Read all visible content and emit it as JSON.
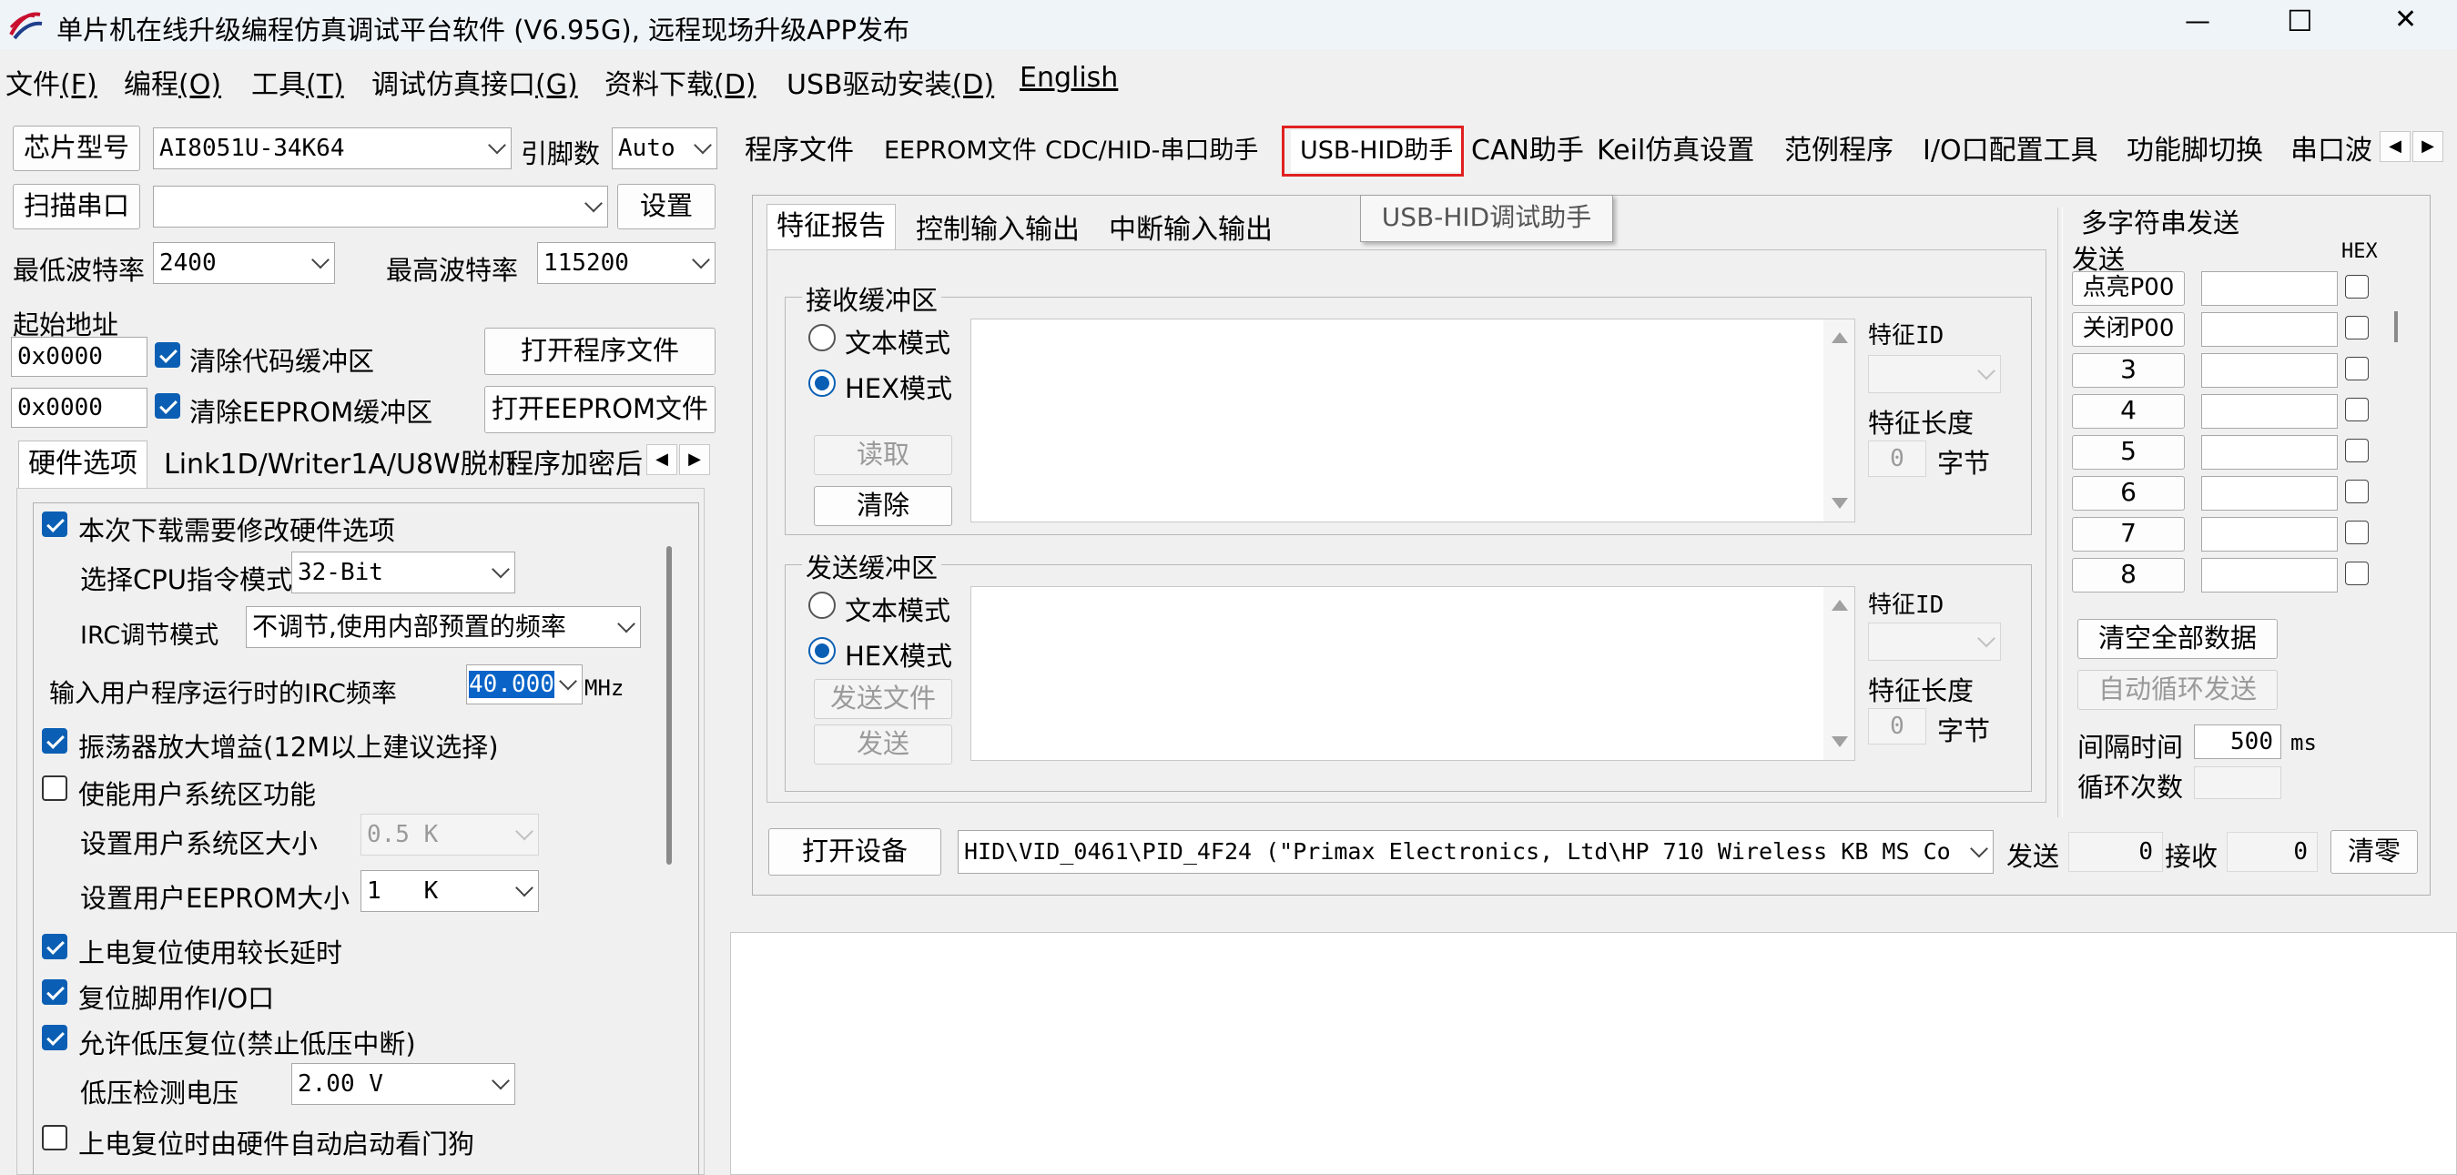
{
  "window": {
    "title": "单片机在线升级编程仿真调试平台软件 (V6.95G), 远程现场升级APP发布",
    "minimize": "—",
    "maximize": "☐",
    "close": "✕"
  },
  "menu": [
    {
      "label": "文件",
      "key": "(F)"
    },
    {
      "label": "编程",
      "key": "(O)"
    },
    {
      "label": "工具",
      "key": "(T)"
    },
    {
      "label": "调试仿真接口",
      "key": "(G)"
    },
    {
      "label": "资料下载",
      "key": "(D)"
    },
    {
      "label": "USB驱动安装",
      "key": "(D)"
    },
    {
      "label": "English",
      "key": ""
    }
  ],
  "left": {
    "chip_btn": "芯片型号",
    "chip_value": "AI8051U-34K64",
    "pins_label": "引脚数",
    "pins_value": "Auto",
    "scan_btn": "扫描串口",
    "port_value": "",
    "settings_btn": "设置",
    "min_baud_label": "最低波特率",
    "min_baud_value": "2400",
    "max_baud_label": "最高波特率",
    "max_baud_value": "115200",
    "start_addr_label": "起始地址",
    "addr1": "0x0000",
    "clear_code_label": "清除代码缓冲区",
    "open_prog_btn": "打开程序文件",
    "addr2": "0x0000",
    "clear_eeprom_label": "清除EEPROM缓冲区",
    "open_eeprom_btn": "打开EEPROM文件",
    "tabs": [
      "硬件选项",
      "Link1D/Writer1A/U8W脱机",
      "程序加密后"
    ],
    "hw": {
      "modify_label": "本次下载需要修改硬件选项",
      "cpu_mode_label": "选择CPU指令模式",
      "cpu_mode_value": "32-Bit",
      "irc_mode_label": "IRC调节模式",
      "irc_mode_value": "不调节,使用内部预置的频率",
      "irc_freq_label": "输入用户程序运行时的IRC频率",
      "irc_freq_value": "40.000",
      "irc_freq_unit": "MHz",
      "osc_gain_label": "振荡器放大增益(12M以上建议选择)",
      "sysarea_label": "使能用户系统区功能",
      "sysarea_size_label": "设置用户系统区大小",
      "sysarea_size_value": "0.5 K",
      "eeprom_size_label": "设置用户EEPROM大小",
      "eeprom_size_value": "1   K",
      "long_delay_label": "上电复位使用较长延时",
      "reset_io_label": "复位脚用作I/O口",
      "lvr_label": "允许低压复位(禁止低压中断)",
      "lvd_label": "低压检测电压",
      "lvd_value": "2.00 V",
      "watchdog_label": "上电复位时由硬件自动启动看门狗"
    }
  },
  "main_tabs": [
    "程序文件",
    "EEPROM文件",
    "CDC/HID-串口助手",
    "USB-HID助手",
    "CAN助手",
    "Keil仿真设置",
    "范例程序",
    "I/O口配置工具",
    "功能脚切换",
    "串口波"
  ],
  "tooltip": "USB-HID调试助手",
  "hid": {
    "subtabs": [
      "特征报告",
      "控制输入输出",
      "中断输入输出"
    ],
    "recv_group": "接收缓冲区",
    "text_mode": "文本模式",
    "hex_mode": "HEX模式",
    "read_btn": "读取",
    "clear_btn": "清除",
    "feature_id_label": "特征ID",
    "feature_len_label": "特征长度",
    "len_value": "0",
    "bytes_unit": "字节",
    "send_group": "发送缓冲区",
    "send_file_btn": "发送文件",
    "send_btn": "发送",
    "open_device_btn": "打开设备",
    "device_value": "HID\\VID_0461\\PID_4F24 (\"Primax Electronics, Ltd\\HP 710 Wireless KB MS Co",
    "send_count_label": "发送",
    "send_count": "0",
    "recv_count_label": "接收",
    "recv_count": "0",
    "reset_btn": "清零"
  },
  "multi": {
    "title": "多字符串发送",
    "send_col": "发送",
    "hex_col": "HEX",
    "rows": [
      "点亮P00",
      "关闭P00",
      "3",
      "4",
      "5",
      "6",
      "7",
      "8"
    ],
    "clear_all_btn": "清空全部数据",
    "auto_loop_btn": "自动循环发送",
    "interval_label": "间隔时间",
    "interval_value": "500",
    "interval_unit": "ms",
    "loop_count_label": "循环次数",
    "loop_count_value": ""
  },
  "colors": {
    "accent": "#0a5fb4",
    "highlight_box": "#e02020",
    "selection": "#0a64c8"
  }
}
